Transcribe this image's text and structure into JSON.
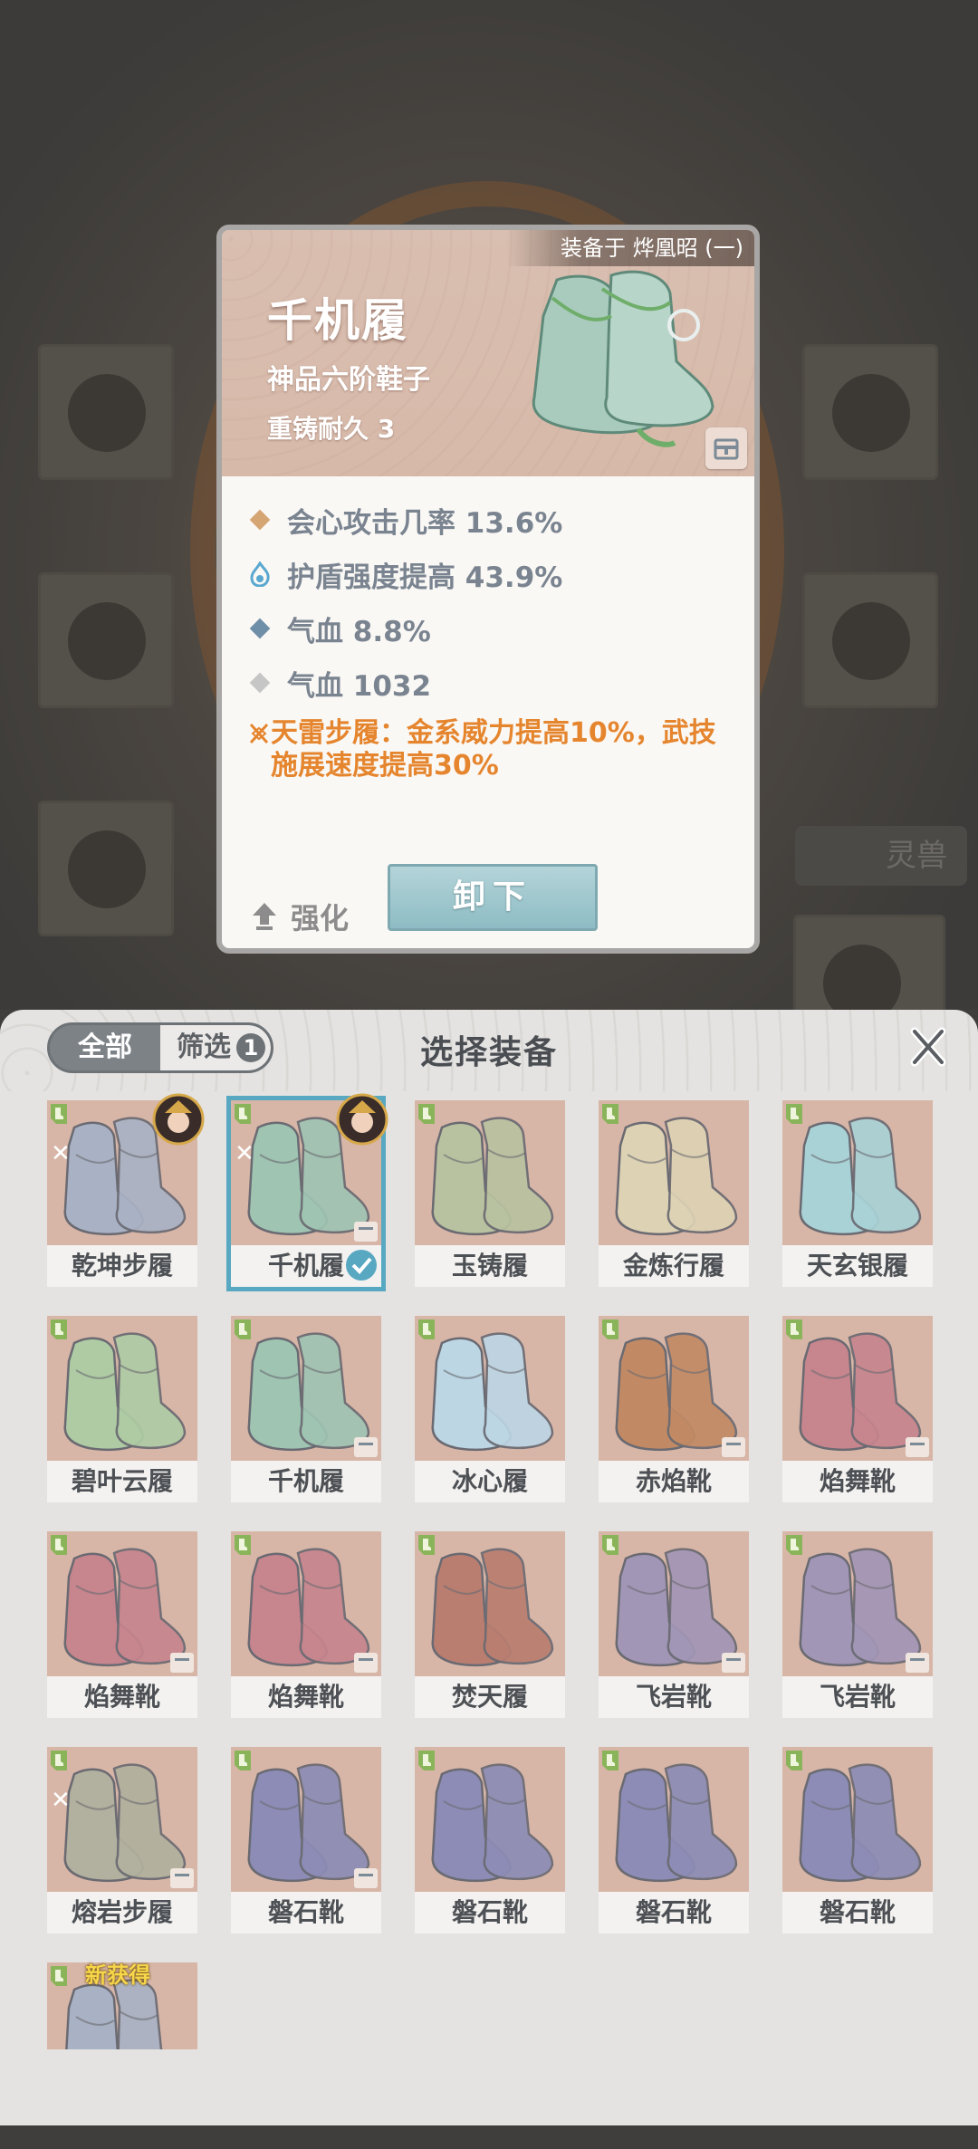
{
  "background": {
    "lingshou_label": "灵兽"
  },
  "detail": {
    "equipped_by": "装备于 烨凰昭 (一)",
    "name": "千机履",
    "type": "神品六阶鞋子",
    "durability": "重铸耐久 3",
    "stats": [
      {
        "icon": "diamond-gold-icon",
        "color": "#d5a574",
        "text": "会心攻击几率 13.6%"
      },
      {
        "icon": "flame-blue-icon",
        "color": "#5aa8d0",
        "text": "护盾强度提高 43.9%"
      },
      {
        "icon": "diamond-blue-icon",
        "color": "#6f8ea8",
        "text": "气血 8.8%"
      },
      {
        "icon": "diamond-gray-icon",
        "color": "#c6c6c6",
        "text": "气血 1032"
      }
    ],
    "set_bonus": "天雷步履：金系威力提高10%，武技施展速度提高30%",
    "strengthen_label": "强化",
    "unload_label": "卸下"
  },
  "panel": {
    "tab_all": "全部",
    "tab_filter": "筛选",
    "filter_count": "1",
    "title": "选择装备"
  },
  "items": [
    {
      "name": "乾坤步履",
      "color": "#a9b2c4",
      "swirl": "✕",
      "portrait": true,
      "lock": false,
      "selected": false
    },
    {
      "name": "千机履",
      "color": "#9fc4b2",
      "swirl": "✕",
      "portrait": true,
      "lock": true,
      "selected": true
    },
    {
      "name": "玉铸履",
      "color": "#b9c2a0",
      "swirl": "",
      "portrait": false,
      "lock": false,
      "selected": false
    },
    {
      "name": "金炼行履",
      "color": "#ddd2b4",
      "swirl": "",
      "portrait": false,
      "lock": false,
      "selected": false
    },
    {
      "name": "天玄银履",
      "color": "#a9d2d6",
      "swirl": "",
      "portrait": false,
      "lock": false,
      "selected": false
    },
    {
      "name": "碧叶云履",
      "color": "#aecba4",
      "swirl": "",
      "portrait": false,
      "lock": false,
      "selected": false
    },
    {
      "name": "千机履",
      "color": "#9fc4b2",
      "swirl": "",
      "portrait": false,
      "lock": true,
      "selected": false
    },
    {
      "name": "冰心履",
      "color": "#bcd6e4",
      "swirl": "",
      "portrait": false,
      "lock": false,
      "selected": false
    },
    {
      "name": "赤焰靴",
      "color": "#c28a64",
      "swirl": "",
      "portrait": false,
      "lock": true,
      "selected": false
    },
    {
      "name": "焰舞靴",
      "color": "#c7858e",
      "swirl": "",
      "portrait": false,
      "lock": true,
      "selected": false
    },
    {
      "name": "焰舞靴",
      "color": "#c7858e",
      "swirl": "",
      "portrait": false,
      "lock": true,
      "selected": false
    },
    {
      "name": "焰舞靴",
      "color": "#c7858e",
      "swirl": "",
      "portrait": false,
      "lock": true,
      "selected": false
    },
    {
      "name": "焚天履",
      "color": "#b97e70",
      "swirl": "",
      "portrait": false,
      "lock": false,
      "selected": false
    },
    {
      "name": "飞岩靴",
      "color": "#a296b6",
      "swirl": "",
      "portrait": false,
      "lock": true,
      "selected": false
    },
    {
      "name": "飞岩靴",
      "color": "#a296b6",
      "swirl": "",
      "portrait": false,
      "lock": true,
      "selected": false
    },
    {
      "name": "熔岩步履",
      "color": "#b2b09e",
      "swirl": "✕",
      "portrait": false,
      "lock": true,
      "selected": false
    },
    {
      "name": "磐石靴",
      "color": "#8d8cb6",
      "swirl": "",
      "portrait": false,
      "lock": true,
      "selected": false
    },
    {
      "name": "磐石靴",
      "color": "#8d8cb6",
      "swirl": "",
      "portrait": false,
      "lock": false,
      "selected": false
    },
    {
      "name": "磐石靴",
      "color": "#8d8cb6",
      "swirl": "",
      "portrait": false,
      "lock": false,
      "selected": false
    },
    {
      "name": "磐石靴",
      "color": "#8d8cb6",
      "swirl": "",
      "portrait": false,
      "lock": false,
      "selected": false
    }
  ],
  "new_item": {
    "tag": "新获得",
    "color": "#a9b2c4"
  },
  "colors": {
    "accent": "#58a8c1",
    "set_bonus": "#e5852e",
    "stat_text": "#7a8490"
  }
}
